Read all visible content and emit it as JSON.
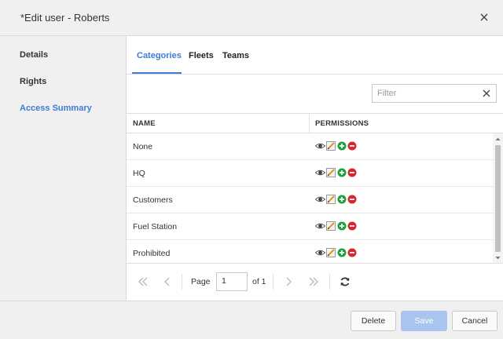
{
  "dialog": {
    "title": "*Edit user - Roberts"
  },
  "sidebar": {
    "items": [
      {
        "label": "Details",
        "active": false
      },
      {
        "label": "Rights",
        "active": false
      },
      {
        "label": "Access Summary",
        "active": true
      }
    ]
  },
  "tabs": [
    {
      "label": "Categories",
      "active": true
    },
    {
      "label": "Fleets",
      "active": false
    },
    {
      "label": "Teams",
      "active": false
    }
  ],
  "filter": {
    "placeholder": "Filter",
    "value": ""
  },
  "table": {
    "columns": [
      "NAME",
      "PERMISSIONS"
    ],
    "rows": [
      {
        "name": "None",
        "permissions": [
          "eye-icon",
          "edit-icon",
          "add-icon",
          "remove-icon"
        ]
      },
      {
        "name": "HQ",
        "permissions": [
          "eye-icon",
          "edit-icon",
          "add-icon",
          "remove-icon"
        ]
      },
      {
        "name": "Customers",
        "permissions": [
          "eye-icon",
          "edit-icon",
          "add-icon",
          "remove-icon"
        ]
      },
      {
        "name": "Fuel Station",
        "permissions": [
          "eye-icon",
          "edit-icon",
          "add-icon",
          "remove-icon"
        ]
      },
      {
        "name": "Prohibited",
        "permissions": [
          "eye-icon",
          "edit-icon",
          "add-icon",
          "remove-icon"
        ]
      }
    ]
  },
  "pager": {
    "page_label": "Page",
    "current_page": "1",
    "of_label": "of 1"
  },
  "footer": {
    "delete_label": "Delete",
    "save_label": "Save",
    "cancel_label": "Cancel"
  },
  "colors": {
    "accent": "#3d7bd6",
    "save_disabled": "#a9c4ee",
    "add_green": "#1aa33a",
    "remove_red": "#d7262e"
  }
}
